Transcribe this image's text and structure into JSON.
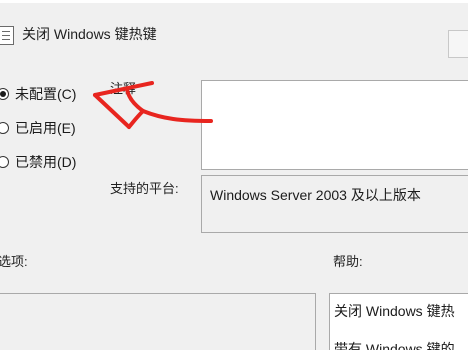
{
  "window": {
    "title": "关闭 Windows 键热键",
    "title_icon": "policy-setting-icon"
  },
  "state_options": [
    {
      "label": "未配置(C)",
      "selected": true
    },
    {
      "label": "已启用(E)",
      "selected": false
    },
    {
      "label": "已禁用(D)",
      "selected": false
    }
  ],
  "comment": {
    "label": "注释",
    "value": ""
  },
  "supported_on": {
    "label": "支持的平台:",
    "value": "Windows Server 2003 及以上版本"
  },
  "options": {
    "label": "选项:"
  },
  "help": {
    "label": "帮助:",
    "lines": [
      "关闭 Windows 键热",
      "带有 Windows 键的"
    ]
  },
  "annotation": {
    "shape": "red-arrow",
    "color": "#e8251f"
  }
}
